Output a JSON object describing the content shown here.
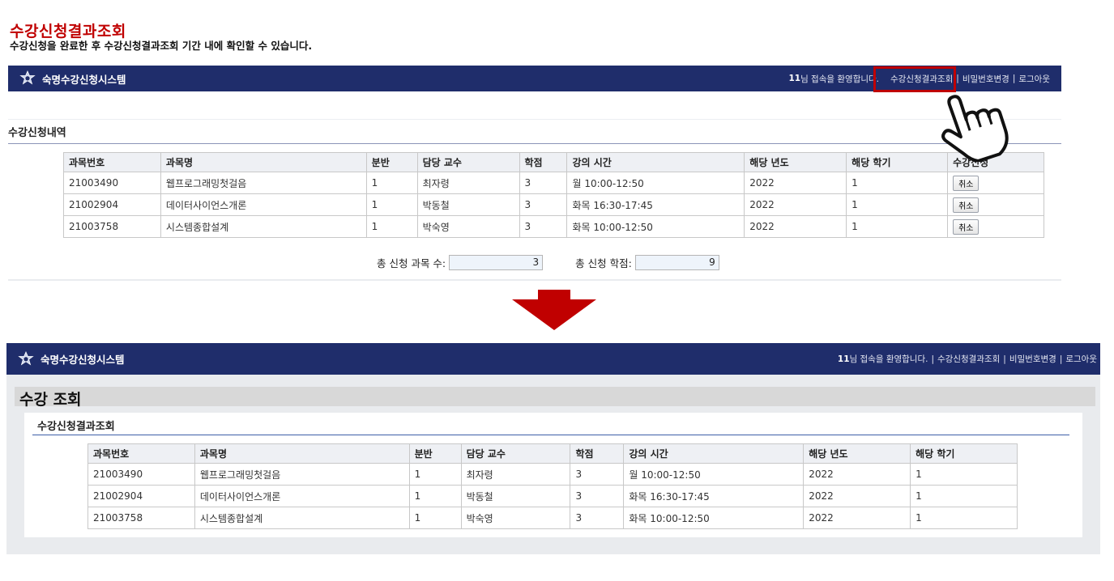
{
  "doc": {
    "title": "수강신청결과조회",
    "subtitle": "수강신청을 완료한 후 수강신청결과조회 기간 내에 확인할 수 있습니다."
  },
  "nav": {
    "brand": "숙명수강신청시스템",
    "user_id": "11",
    "welcome": "님 접속을 환영합니다.",
    "links": [
      "수강신청결과조회",
      "비밀번호변경",
      "로그아웃"
    ],
    "separator": "|"
  },
  "before": {
    "section_title": "수강신청내역",
    "headers": [
      "과목번호",
      "과목명",
      "분반",
      "담당 교수",
      "학점",
      "강의 시간",
      "해당 년도",
      "해당 학기",
      "수강신청"
    ],
    "rows": [
      [
        "21003490",
        "웹프로그래밍첫걸음",
        "1",
        "최자령",
        "3",
        "월 10:00-12:50",
        "2022",
        "1"
      ],
      [
        "21002904",
        "데이터사이언스개론",
        "1",
        "박동철",
        "3",
        "화목 16:30-17:45",
        "2022",
        "1"
      ],
      [
        "21003758",
        "시스템종합설계",
        "1",
        "박숙영",
        "3",
        "화목 10:00-12:50",
        "2022",
        "1"
      ]
    ],
    "cancel_label": "취소",
    "summary": {
      "count_label": "총 신청 과목 수:",
      "count_value": "3",
      "credit_label": "총 신청 학점:",
      "credit_value": "9"
    }
  },
  "after": {
    "page_title": "수강 조회",
    "section_title": "수강신청결과조회",
    "headers": [
      "과목번호",
      "과목명",
      "분반",
      "담당 교수",
      "학점",
      "강의 시간",
      "해당 년도",
      "해당 학기"
    ],
    "rows": [
      [
        "21003490",
        "웹프로그래밍첫걸음",
        "1",
        "최자령",
        "3",
        "월 10:00-12:50",
        "2022",
        "1"
      ],
      [
        "21002904",
        "데이터사이언스개론",
        "1",
        "박동철",
        "3",
        "화목 16:30-17:45",
        "2022",
        "1"
      ],
      [
        "21003758",
        "시스템종합설계",
        "1",
        "박숙영",
        "3",
        "화목 10:00-12:50",
        "2022",
        "1"
      ]
    ]
  },
  "colors": {
    "navbar": "#1f2d6b",
    "accent_red": "#c00000",
    "table_header": "#eef0f4"
  },
  "icons": [
    "university-emblem-icon",
    "down-arrow-icon",
    "pointing-hand-cursor-icon"
  ]
}
